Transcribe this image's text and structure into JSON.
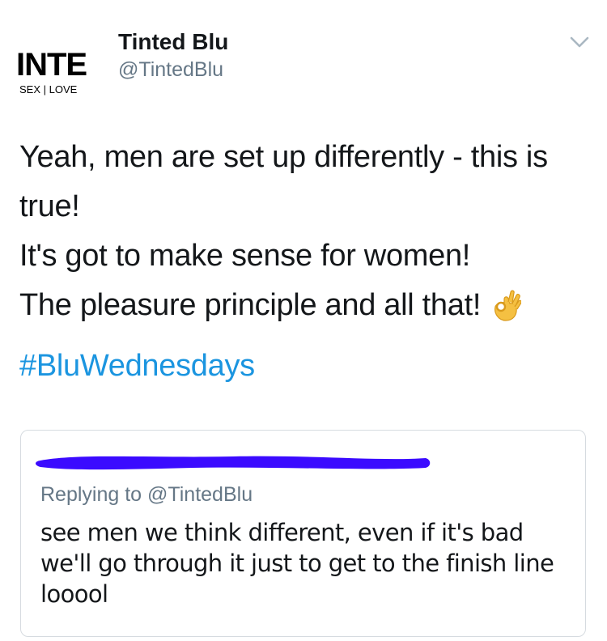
{
  "author": {
    "display_name": "Tinted Blu",
    "handle": "@TintedBlu",
    "avatar_text": "INTE",
    "avatar_subtext": "SEX | LOVE"
  },
  "tweet": {
    "lines": [
      "Yeah, men are set up differently - this is",
      "true!",
      "It's got to make sense for women!",
      "The pleasure principle and all that!"
    ],
    "emoji": "ok-hand-icon",
    "hashtag": "#BluWednesdays"
  },
  "quoted": {
    "replying_prefix": "Replying to ",
    "replying_handle": "@TintedBlu",
    "lines": [
      "see men we think different, even if it's bad",
      "we'll go through it just to get to the finish line",
      "looool"
    ]
  },
  "colors": {
    "link": "#1b95e0",
    "secondary_text": "#657786",
    "redaction": "#3b0bff",
    "card_border": "#d6dbe0"
  }
}
